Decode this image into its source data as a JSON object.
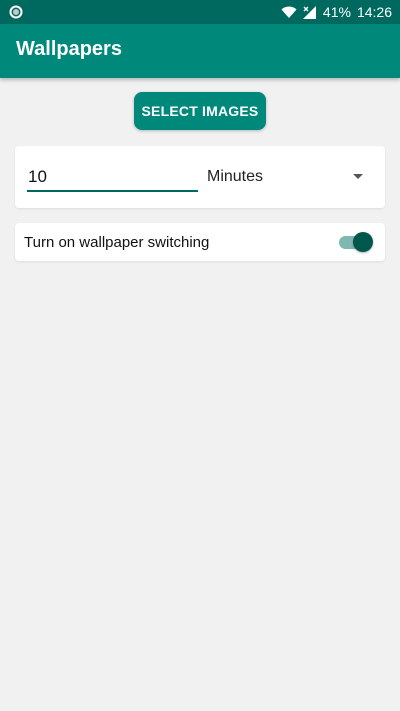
{
  "status_bar": {
    "battery": "41%",
    "time": "14:26",
    "left_icon": "circle-notification-icon",
    "wifi_icon": "wifi-icon",
    "signal_icon": "signal-no-data-icon"
  },
  "app_bar": {
    "title": "Wallpapers"
  },
  "actions": {
    "select_images_label": "SELECT IMAGES"
  },
  "interval": {
    "value": "10",
    "unit": "Minutes",
    "dropdown_icon": "dropdown-arrow-icon"
  },
  "switching": {
    "label": "Turn on wallpaper switching",
    "enabled": true
  },
  "colors": {
    "status_bar": "#00695f",
    "app_bar": "#00897b",
    "accent": "#00574b",
    "background": "#f1f1f1"
  }
}
